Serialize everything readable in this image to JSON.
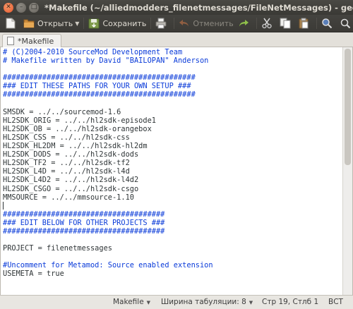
{
  "window": {
    "title": "*Makefile (~/alliedmodders_filenetmessages/FileNetMessages) - gedit",
    "close_glyph": "✕",
    "min_glyph": "–",
    "max_glyph": "□"
  },
  "toolbar": {
    "open_label": "Открыть",
    "open_arrow": "▼",
    "save_label": "Сохранить",
    "undo_label": "Отменить"
  },
  "tab": {
    "label": "*Makefile"
  },
  "editor": {
    "lines": [
      {
        "text": "# (C)2004-2010 SourceMod Development Team",
        "type": "comment"
      },
      {
        "text": "# Makefile written by David \"BAILOPAN\" Anderson",
        "type": "comment"
      },
      {
        "text": "",
        "type": "plain"
      },
      {
        "text": "############################################",
        "type": "comment"
      },
      {
        "text": "### EDIT THESE PATHS FOR YOUR OWN SETUP ###",
        "type": "comment"
      },
      {
        "text": "############################################",
        "type": "comment"
      },
      {
        "text": "",
        "type": "plain"
      },
      {
        "text": "SMSDK = ../../sourcemod-1.6",
        "type": "plain"
      },
      {
        "text": "HL2SDK_ORIG = ../../hl2sdk-episode1",
        "type": "plain"
      },
      {
        "text": "HL2SDK_OB = ../../hl2sdk-orangebox",
        "type": "plain"
      },
      {
        "text": "HL2SDK_CSS = ../../hl2sdk-css",
        "type": "plain"
      },
      {
        "text": "HL2SDK_HL2DM = ../../hl2sdk-hl2dm",
        "type": "plain"
      },
      {
        "text": "HL2SDK_DODS = ../../hl2sdk-dods",
        "type": "plain"
      },
      {
        "text": "HL2SDK_TF2 = ../../hl2sdk-tf2",
        "type": "plain"
      },
      {
        "text": "HL2SDK_L4D = ../../hl2sdk-l4d",
        "type": "plain"
      },
      {
        "text": "HL2SDK_L4D2 = ../../hl2sdk-l4d2",
        "type": "plain"
      },
      {
        "text": "HL2SDK_CSGO = ../../hl2sdk-csgo",
        "type": "plain"
      },
      {
        "text": "MMSOURCE = ../../mmsource-1.10",
        "type": "plain"
      },
      {
        "text": "",
        "type": "cursor"
      },
      {
        "text": "#####################################",
        "type": "comment"
      },
      {
        "text": "### EDIT BELOW FOR OTHER PROJECTS ###",
        "type": "comment"
      },
      {
        "text": "#####################################",
        "type": "comment"
      },
      {
        "text": "",
        "type": "plain"
      },
      {
        "text": "PROJECT = filenetmessages",
        "type": "plain"
      },
      {
        "text": "",
        "type": "plain"
      },
      {
        "text": "#Uncomment for Metamod: Source enabled extension",
        "type": "comment"
      },
      {
        "text": "USEMETA = true",
        "type": "plain"
      }
    ]
  },
  "status": {
    "language": "Makefile",
    "tab_width": "Ширина табуляции: 8",
    "position": "Стр 19, Стлб 1",
    "mode": "ВСТ",
    "dropdown_glyph": "▼"
  },
  "colors": {
    "comment": "#0a3bd9",
    "text": "#2e3436",
    "titlebar": "#3c3b37",
    "close_button": "#e5562b"
  }
}
